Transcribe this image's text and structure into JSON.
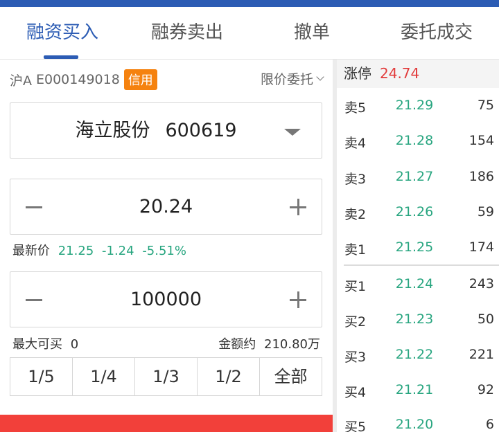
{
  "tabs": [
    "融资买入",
    "融券卖出",
    "撤单",
    "委托成交"
  ],
  "account": {
    "market": "沪A",
    "id": "E000149018",
    "badge": "信用",
    "order_type": "限价委托"
  },
  "stock": {
    "name": "海立股份",
    "code": "600619"
  },
  "price": {
    "value": "20.24"
  },
  "latest": {
    "label": "最新价",
    "price": "21.25",
    "change": "-1.24",
    "pct": "-5.51%"
  },
  "quantity": {
    "value": "100000"
  },
  "max_buy": {
    "label": "最大可买",
    "value": "0"
  },
  "amount": {
    "label": "金额约",
    "value": "210.80万"
  },
  "fractions": [
    "1/5",
    "1/4",
    "1/3",
    "1/2",
    "全部"
  ],
  "orderbook": {
    "limit_up_label": "涨停",
    "limit_up_price": "24.74",
    "asks": [
      {
        "label": "卖5",
        "price": "21.29",
        "volume": "75"
      },
      {
        "label": "卖4",
        "price": "21.28",
        "volume": "154"
      },
      {
        "label": "卖3",
        "price": "21.27",
        "volume": "186"
      },
      {
        "label": "卖2",
        "price": "21.26",
        "volume": "59"
      },
      {
        "label": "卖1",
        "price": "21.25",
        "volume": "174"
      }
    ],
    "bids": [
      {
        "label": "买1",
        "price": "21.24",
        "volume": "243"
      },
      {
        "label": "买2",
        "price": "21.23",
        "volume": "50"
      },
      {
        "label": "买3",
        "price": "21.22",
        "volume": "221"
      },
      {
        "label": "买4",
        "price": "21.21",
        "volume": "92"
      },
      {
        "label": "买5",
        "price": "21.20",
        "volume": "6"
      }
    ]
  },
  "colors": {
    "accent": "#2c5cb4",
    "up": "#e23b3b",
    "down": "#27a57f",
    "badge": "#f5820f",
    "buy": "#f2403a"
  }
}
